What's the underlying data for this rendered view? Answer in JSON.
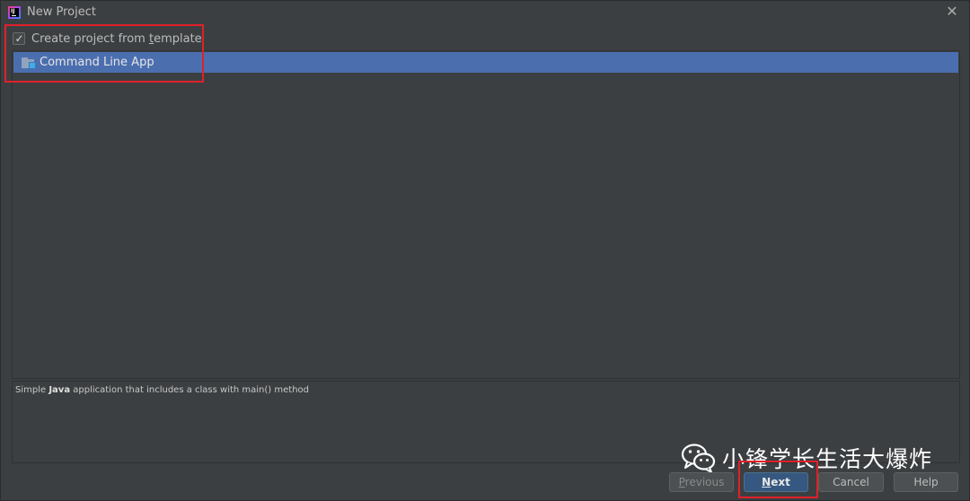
{
  "window": {
    "title": "New Project",
    "close_icon": "close-icon"
  },
  "template_option": {
    "label_pre": "Create project from ",
    "label_mnemonic": "t",
    "label_post": "emplate",
    "checked": true
  },
  "templates": {
    "items": [
      {
        "label": "Command Line App",
        "icon": "folder-java-icon",
        "selected": true
      }
    ]
  },
  "description": {
    "prefix": "Simple ",
    "bold": "Java",
    "suffix": " application that includes a class with main() method"
  },
  "buttons": {
    "previous": {
      "mnemonic": "P",
      "rest": "revious",
      "enabled": false
    },
    "next": {
      "mnemonic": "N",
      "rest": "ext",
      "default": true
    },
    "cancel": {
      "label": "Cancel"
    },
    "help": {
      "label": "Help"
    }
  },
  "watermark": {
    "text": "小锋学长生活大爆炸",
    "icon": "wechat-icon"
  },
  "colors": {
    "background": "#3c3f41",
    "selection": "#4b6eaf",
    "default_button": "#365880",
    "annotation": "#e0202a"
  }
}
